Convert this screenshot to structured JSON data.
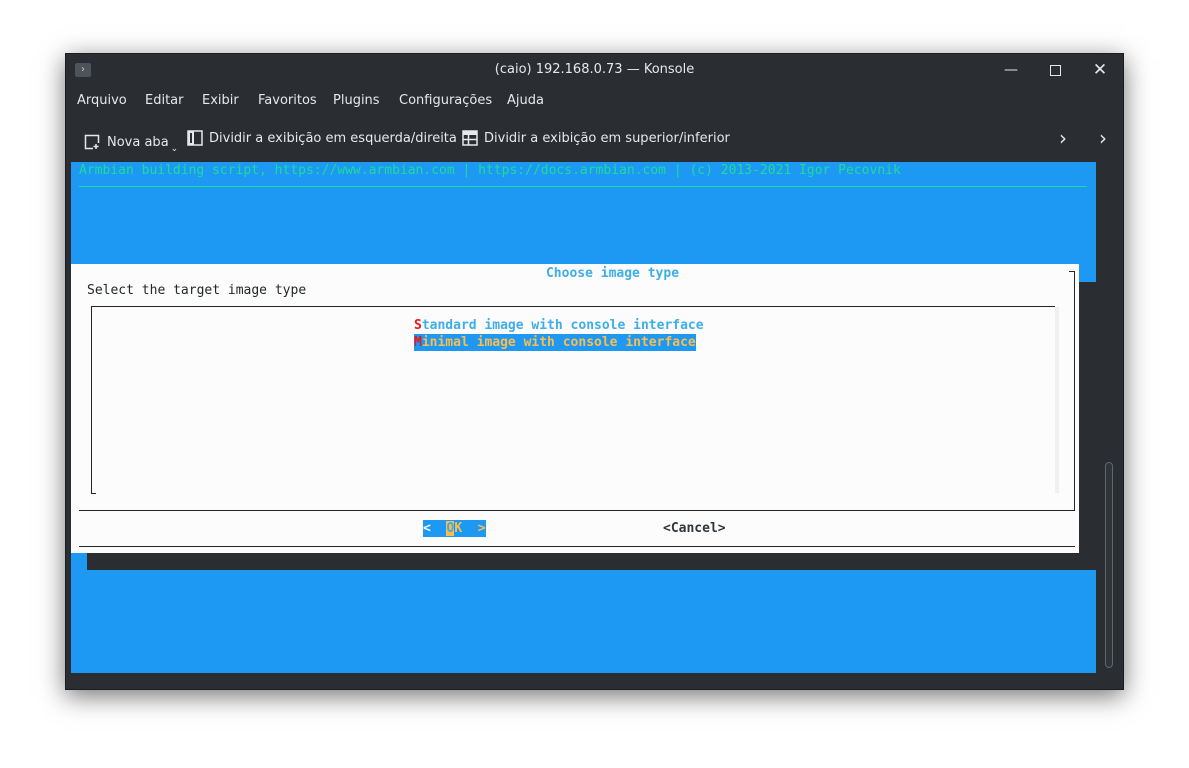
{
  "window": {
    "title": "(caio) 192.168.0.73 — Konsole",
    "app_icon": "terminal-icon",
    "controls": {
      "minimize": "minimize-icon",
      "maximize": "maximize-icon",
      "close": "close-icon"
    }
  },
  "menubar": {
    "items": [
      "Arquivo",
      "Editar",
      "Exibir",
      "Favoritos",
      "Plugins",
      "Configurações",
      "Ajuda"
    ]
  },
  "toolbar": {
    "new_tab": "Nova aba",
    "split_lr": "Dividir a exibição em esquerda/direita",
    "split_tb": "Dividir a exibição em superior/inferior"
  },
  "terminal": {
    "banner": "Armbian building script, https://www.armbian.com | https://docs.armbian.com | (c) 2013-2021 Igor Pecovnik",
    "dialog": {
      "title": "Choose image type",
      "prompt": "Select the target image type",
      "options": [
        {
          "hotkey": "S",
          "rest": "tandard image with console interface",
          "selected": false
        },
        {
          "hotkey": "M",
          "rest": "inimal image with console interface",
          "selected": true
        }
      ],
      "ok": {
        "left": "<  ",
        "hotkey": "O",
        "rest": "K  >"
      },
      "cancel": "<Cancel>"
    }
  },
  "colors": {
    "terminal_bg": "#2a2e32",
    "blue": "#1d99f3",
    "green": "#1cdc9a",
    "dialog_bg": "#fcfcfc",
    "title_color": "#3daee9",
    "highlight": "#fdbc4b",
    "hotkey": "#ed1515"
  }
}
